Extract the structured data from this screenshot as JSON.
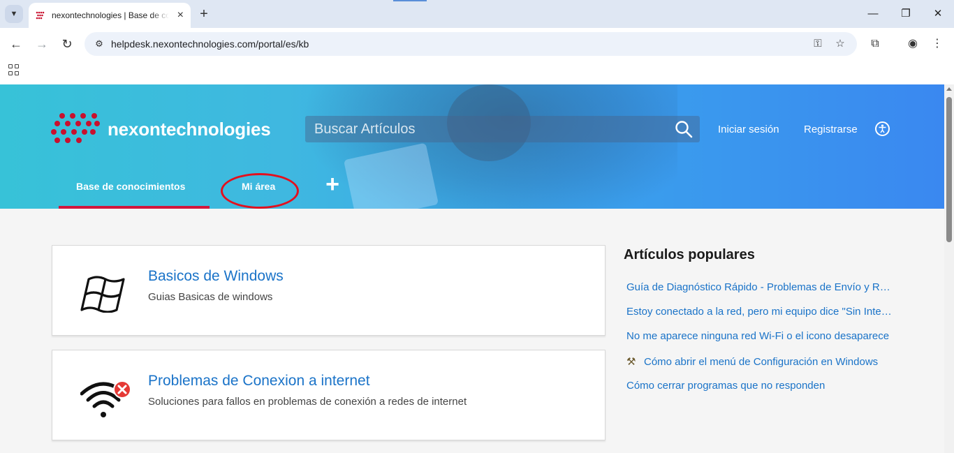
{
  "browser": {
    "tab_title": "nexontechnologies | Base de conocimientos",
    "url": "helpdesk.nexontechnologies.com/portal/es/kb"
  },
  "header": {
    "logo_text": "nexontechnologies",
    "search_placeholder": "Buscar Artículos",
    "login_label": "Iniciar sesión",
    "register_label": "Registrarse"
  },
  "nav": {
    "tabs": [
      {
        "label": "Base de conocimientos",
        "active": true
      },
      {
        "label": "Mi área",
        "active": false
      }
    ],
    "highlight_color": "#e3101e",
    "active_underline_color": "#d2163d"
  },
  "categories": [
    {
      "title": "Basicos de Windows",
      "description": "Guias Basicas de windows",
      "icon": "windows-logo-icon"
    },
    {
      "title": "Problemas de Conexion a internet",
      "description": "Soluciones para fallos en problemas de conexión a redes de internet",
      "icon": "wifi-error-icon"
    }
  ],
  "popular": {
    "title": "Artículos populares",
    "items": [
      {
        "label": "Guía de Diagnóstico Rápido - Problemas de Envío y Recepción de Correos"
      },
      {
        "label": "Estoy conectado a la red, pero mi equipo dice \"Sin Internet\""
      },
      {
        "label": "No me aparece ninguna red Wi-Fi o el icono desaparece"
      },
      {
        "label": "Cómo abrir el menú de Configuración en Windows",
        "icon": "tools-icon"
      },
      {
        "label": "Cómo cerrar programas que no responden"
      }
    ]
  },
  "colors": {
    "link": "#1a73c8",
    "brand_red": "#c8102e"
  }
}
